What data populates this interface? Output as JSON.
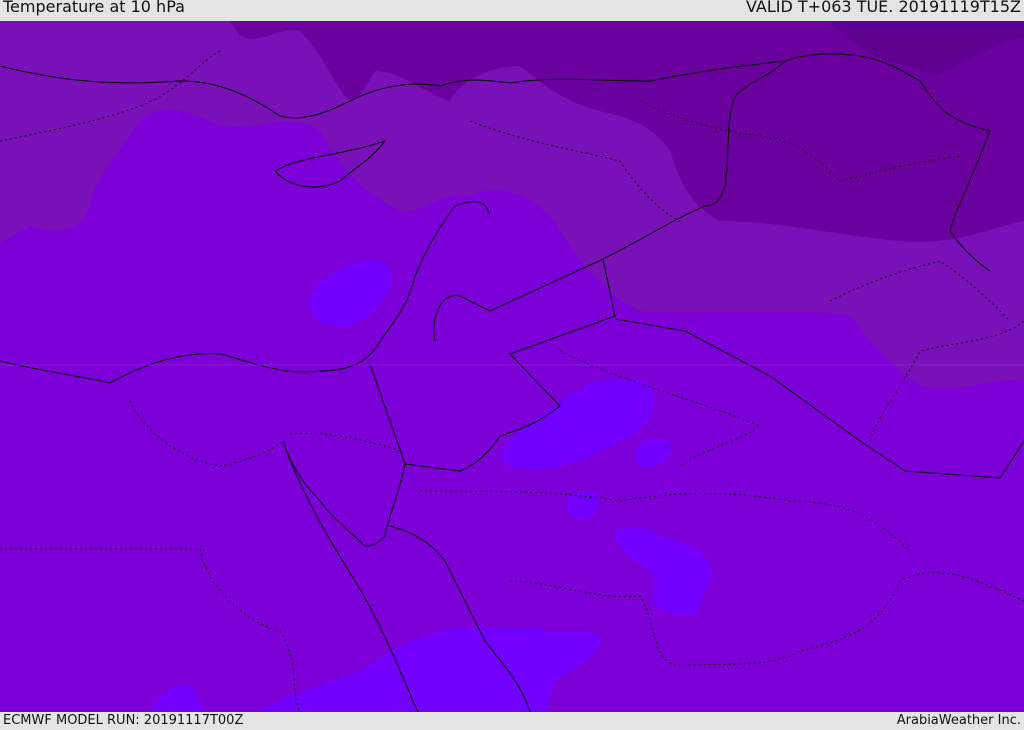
{
  "header": {
    "title": "Temperature at 10 hPa",
    "valid_time": "VALID T+063 TUE. 20191119T15Z"
  },
  "footer": {
    "model_run": "ECMWF MODEL RUN: 20191117T00Z",
    "credit": "ArabiaWeather Inc."
  },
  "colors": {
    "base": "#7d00d8",
    "warm": "#7300ff",
    "cool1": "#7a10b8",
    "cool2": "#6a009e",
    "cool3": "#5e0090"
  }
}
